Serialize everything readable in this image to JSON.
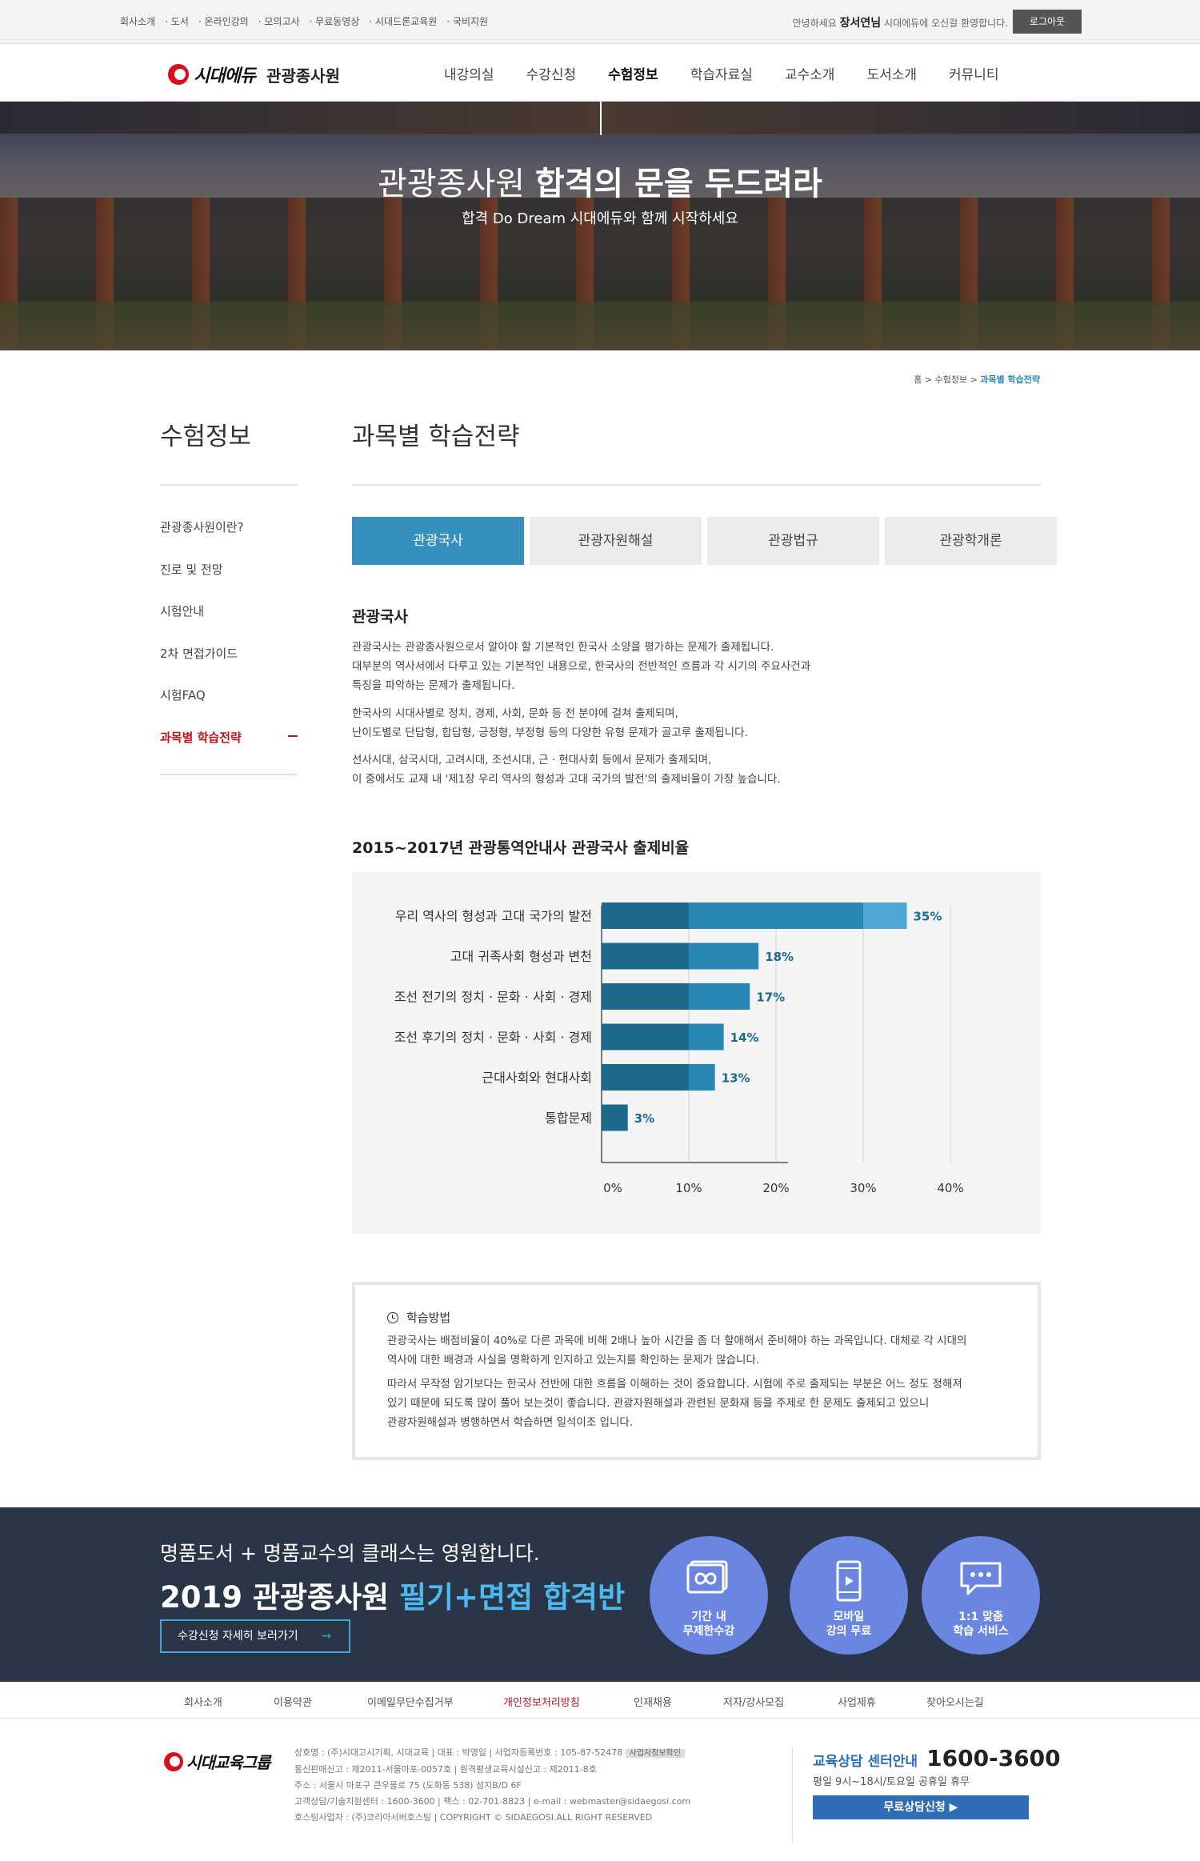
{
  "topbar": {
    "links": [
      "회사소개",
      "· 도서",
      "· 온라인강의",
      "· 모의고사",
      "· 무료동영상",
      "· 시대드론교육원",
      "· 국비지원"
    ],
    "welcome_prefix": "안녕하세요",
    "user_name": "장서연님",
    "welcome_suffix": "시대에듀에 오신걸 환영합니다.",
    "logout_label": "로그아웃"
  },
  "header": {
    "logo_text": "시대에듀",
    "logo_sub": "관광종사원",
    "nav": [
      "내강의실",
      "수강신청",
      "수험정보",
      "학습자료실",
      "교수소개",
      "도서소개",
      "커뮤니티"
    ],
    "nav_active": "수험정보"
  },
  "hero": {
    "title_normal": "관광종사원 ",
    "title_bold": "합격의 문을 두드려라",
    "subtitle": "합격 Do Dream 시대에듀와 함께 시작하세요"
  },
  "breadcrumb": {
    "home": "홈",
    "sep": " > ",
    "level1": "수험정보",
    "current": "과목별 학습전략"
  },
  "sidebar": {
    "title": "수험정보",
    "items": [
      "관광종사원이란?",
      "진로 및 전망",
      "시험안내",
      "2차 면접가이드",
      "시험FAQ",
      "과목별 학습전략"
    ],
    "active_index": 5
  },
  "main": {
    "title": "과목별 학습전략",
    "tabs": [
      "관광국사",
      "관광자원해설",
      "관광법규",
      "관광학개론"
    ],
    "active_tab": 0,
    "section_title": "관광국사",
    "paragraphs": [
      [
        "관광국사는 관광종사원으로서 알아야 할 기본적인 한국사 소양을 평가하는 문제가 출제됩니다.",
        "대부분의 역사서에서 다루고 있는 기본적인 내용으로, 한국사의 전반적인 흐름과 각 시기의 주요사건과",
        "특징을 파악하는 문제가 출제됩니다."
      ],
      [
        "한국사의 시대사별로 정치, 경제, 사회, 문화 등 전 분야에 걸쳐 출제되며,",
        "난이도별로 단답형, 합답형, 긍정형, 부정형 등의 다양한 유형 문제가 골고루 출제됩니다."
      ],
      [
        "선사시대, 삼국시대, 고려시대, 조선시대, 근 · 현대사회 등에서 문제가 출제되며,",
        "이 중에서도 교재 내 '제1장 우리 역사의 형성과 고대 국가의 발전'의 출제비율이 가장 높습니다."
      ]
    ],
    "chart_title": "2015~2017년 관광통역안내사 관광국사 출제비율"
  },
  "chart_data": {
    "type": "bar",
    "orientation": "horizontal",
    "title": "2015~2017년 관광통역안내사 관광국사 출제비율",
    "categories": [
      "우리 역사의 형성과 고대 국가의 발전",
      "고대 귀족사회 형성과 변천",
      "조선 전기의 정치 · 문화 · 사회 · 경제",
      "조선 후기의 정치 · 문화 · 사회 · 경제",
      "근대사회와 현대사회",
      "통합문제"
    ],
    "values": [
      35,
      18,
      17,
      14,
      13,
      3
    ],
    "value_labels": [
      "35%",
      "18%",
      "17%",
      "14%",
      "13%",
      "3%"
    ],
    "xticks": [
      "0%",
      "10%",
      "20%",
      "30%",
      "40%"
    ],
    "xlim": [
      0,
      45
    ],
    "grid": true,
    "colors": {
      "bar_dark": "#1d6a8c",
      "bar_mid": "#2987b3",
      "bar_light": "#4ea6d4",
      "label": "#1d6a8c"
    }
  },
  "method": {
    "title": "학습방법",
    "lines1": [
      "관광국사는 배점비율이 40%로 다른 과목에 비해 2배나 높아 시간을 좀 더 할애해서 준비해야 하는 과목입니다. 대체로 각 시대의",
      "역사에 대한 배경과 사실을 명확하게 인지하고 있는지를 확인하는 문제가 많습니다."
    ],
    "lines2": [
      "따라서 무작정 암기보다는 한국사 전반에 대한 흐름을 이해하는 것이 중요합니다. 시험에 주로 출제되는 부분은 어느 정도 정해져",
      "있기 때문에 되도록 많이 풀어 보는것이 좋습니다. 관광자원해설과 관련된 문화재 등을 주제로 한 문제도 출제되고 있으니",
      "관광자원해설과 병행하면서 학습하면 일석이조 입니다."
    ]
  },
  "banner": {
    "line1": "명품도서 + 명품교수의 클래스는 영원합니다.",
    "line2_prefix": "2019 관광종사원 ",
    "line2_highlight": "필기+면접 합격반",
    "button": "수강신청 자세히 보러가기",
    "button_arrow": "→",
    "circles": [
      {
        "icon": "infinity-icon",
        "l1": "기간 내",
        "l2": "무제한수강"
      },
      {
        "icon": "mobile-icon",
        "l1": "모바일",
        "l2": "강의 무료"
      },
      {
        "icon": "chat-icon",
        "l1": "1:1 맞춤",
        "l2": "학습 서비스"
      }
    ],
    "circle_color": "#6b86e0"
  },
  "footer": {
    "nav": [
      "회사소개",
      "이용약관",
      "이메일무단수집거부",
      "개인정보처리방침",
      "인재채용",
      "저자/강사모집",
      "사업제휴",
      "찾아오시는길"
    ],
    "nav_highlight_index": 3,
    "logo_text": "시대교육그룹",
    "info": [
      "상호명 : (주)시대고시기획, 시대교육 | 대표 : 박영일 | 사업자등록번호 : 105-87-52478",
      "통신판매신고 : 제2011-서울마포-0057호 | 원격평생교육시설신고 : 제2011-8호",
      "주소 : 서울시 마포구 큰우물로 75 (도화동 538) 성지B/D 6F",
      "고객상담/기술지원센터 : 1600-3600 | 팩스 : 02-701-8823 | e-mail : webmaster@sidaegosi.com",
      "호스팅사업자 : (주)코리아서버호스팅 | COPYRIGHT © SIDAEGOSI.ALL RIGHT RESERVED"
    ],
    "info_tag": "사업자정보확인",
    "call_label": "교육상담 센터안내",
    "call_number": "1600-3600",
    "hours": "평일 9시~18시/토요일 공휴일 휴무",
    "consult_button": "무료상담신청 ▶"
  }
}
